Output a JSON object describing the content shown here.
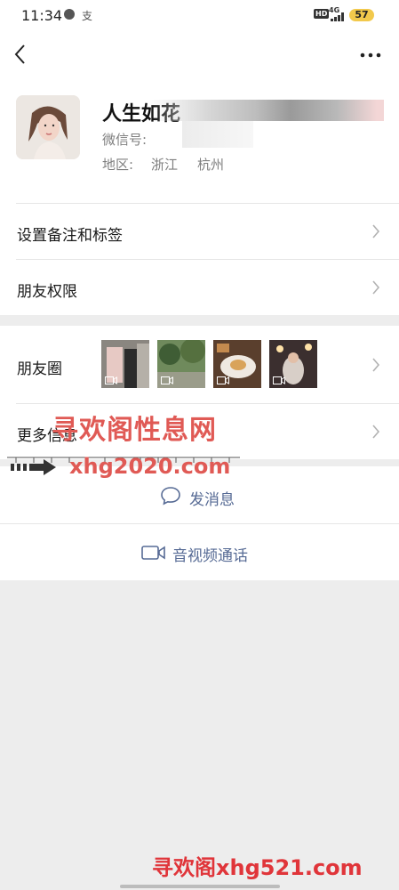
{
  "status_bar": {
    "time": "11:34",
    "carrier_glyph": "支",
    "hd_badge": "HD",
    "network": "4G",
    "battery": "57"
  },
  "nav": {
    "back_icon": "chevron-left-icon",
    "more_icon": "more-dots-icon"
  },
  "profile": {
    "name": "人生如花",
    "wechat_id_label": "微信号:",
    "region_label": "地区:",
    "region_province": "浙江",
    "region_city": "杭州"
  },
  "rows": {
    "remark": "设置备注和标签",
    "permissions": "朋友权限",
    "moments": "朋友圈",
    "more_info": "更多信息"
  },
  "actions": {
    "send_message": "发消息",
    "video_call": "音视频通话"
  },
  "watermarks": {
    "line1": "寻欢阁性息网",
    "line2": "xhg2020.com",
    "footer": "寻欢阁xhg521.com"
  },
  "colors": {
    "link_blue": "#576b95",
    "background": "#ededed",
    "watermark_red": "#e05a55"
  }
}
